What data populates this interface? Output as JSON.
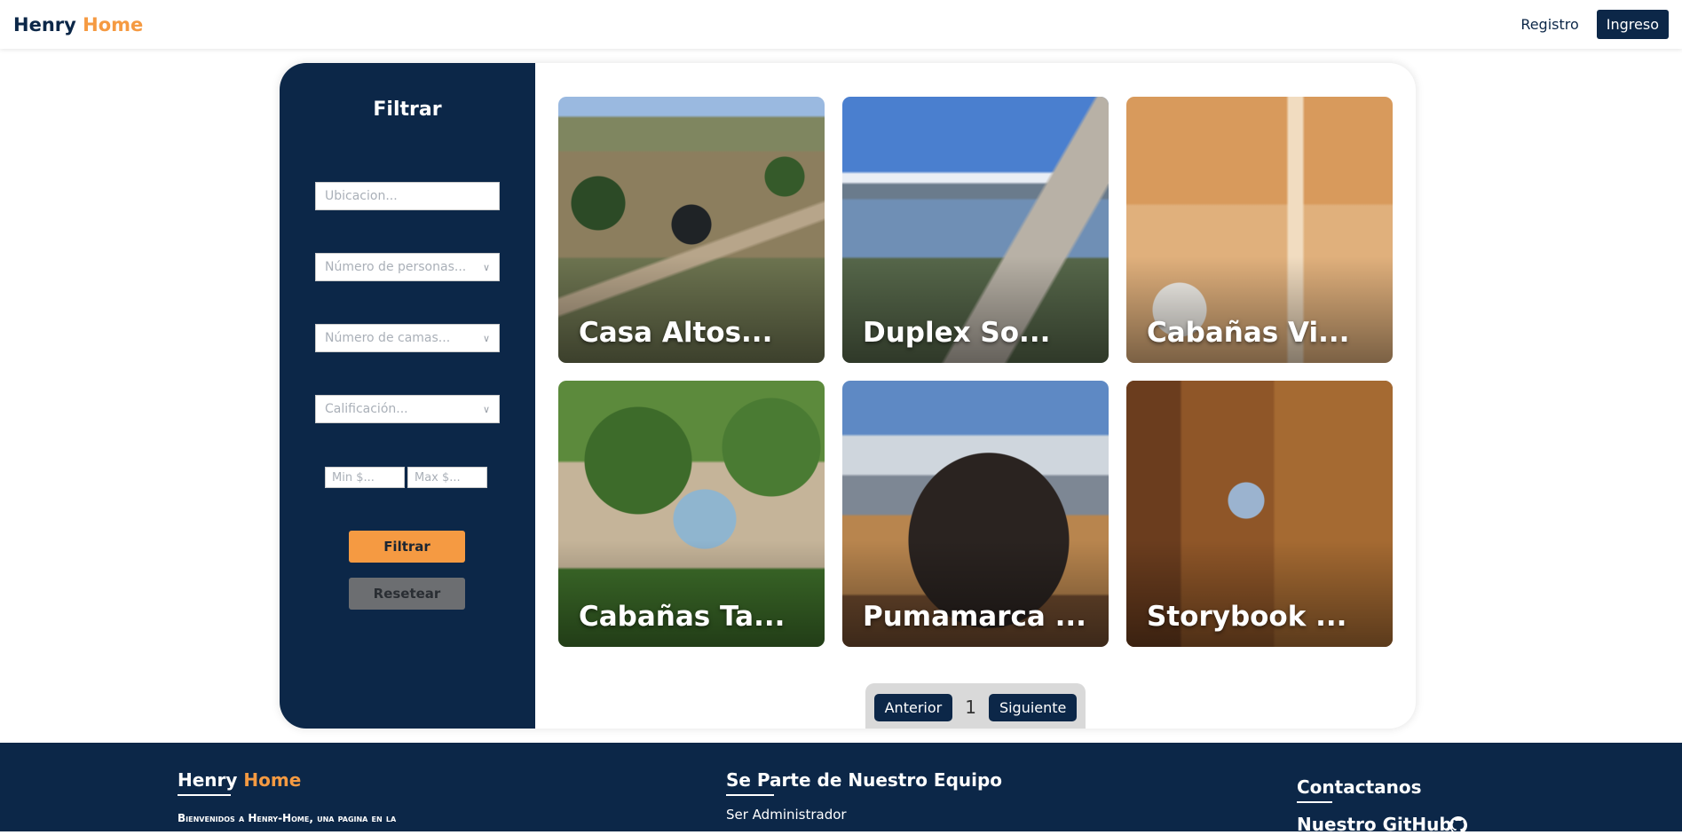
{
  "navbar": {
    "brand_primary": "Henry",
    "brand_accent": "Home",
    "registro_label": "Registro",
    "ingreso_label": "Ingreso"
  },
  "filter": {
    "title": "Filtrar",
    "location_placeholder": "Ubicacion...",
    "people_placeholder": "Número de personas...",
    "beds_placeholder": "Número de camas...",
    "rating_placeholder": "Calificación...",
    "min_price_placeholder": "Min $...",
    "max_price_placeholder": "Max $...",
    "filter_button": "Filtrar",
    "reset_button": "Resetear"
  },
  "listings": [
    {
      "title": "Casa Altos..."
    },
    {
      "title": "Duplex So..."
    },
    {
      "title": "Cabañas Vi..."
    },
    {
      "title": "Cabañas Ta..."
    },
    {
      "title": "Pumamarca ..."
    },
    {
      "title": "Storybook ..."
    }
  ],
  "pagination": {
    "prev_label": "Anterior",
    "current_page": "1",
    "next_label": "Siguiente"
  },
  "footer": {
    "brand_primary": "Henry",
    "brand_accent": "Home",
    "description": "Bienvenidos a Henry-Home, una pagina en la",
    "team_heading": "Se Parte de Nuestro Equipo",
    "admin_link": "Ser Administrador",
    "contact_heading": "Contactanos",
    "github_label": "Nuestro GitHub"
  },
  "colors": {
    "navy": "#0c2748",
    "accent_orange": "#f59a42",
    "reset_gray": "#6c6e71",
    "pagination_bg": "#d9d9d9"
  },
  "icons": {
    "select_chevron": "chevron-down-icon",
    "github": "github-icon"
  }
}
